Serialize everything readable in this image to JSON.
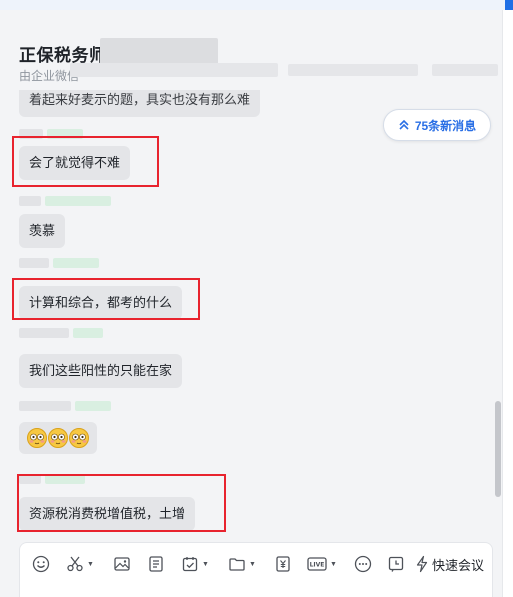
{
  "header": {
    "title": "正保税务师",
    "subtitle": "由企业微信"
  },
  "new_messages": {
    "label": "75条新消息"
  },
  "messages": [
    {
      "text": "着起来好麦示的题，具实也没有那么难"
    },
    {
      "text": "会了就觉得不难"
    },
    {
      "text": "羡慕"
    },
    {
      "text": "计算和综合，都考的什么"
    },
    {
      "text": "我们这些阳性的只能在家"
    },
    {
      "text": "😳😳😳"
    },
    {
      "text": "资源税消费税增值税，土增"
    }
  ],
  "toolbar": {
    "quick_meeting": "快速会议",
    "tools": [
      "emoji-icon",
      "scissors-icon",
      "image-icon",
      "document-icon",
      "calendar-check-icon",
      "folder-icon",
      "yen-icon",
      "live-icon",
      "more-icon",
      "clock-icon",
      "lightning-icon"
    ]
  },
  "colors": {
    "accent": "#2a6fe5",
    "highlight": "#e8232e",
    "bubble": "#e4e5e8"
  }
}
